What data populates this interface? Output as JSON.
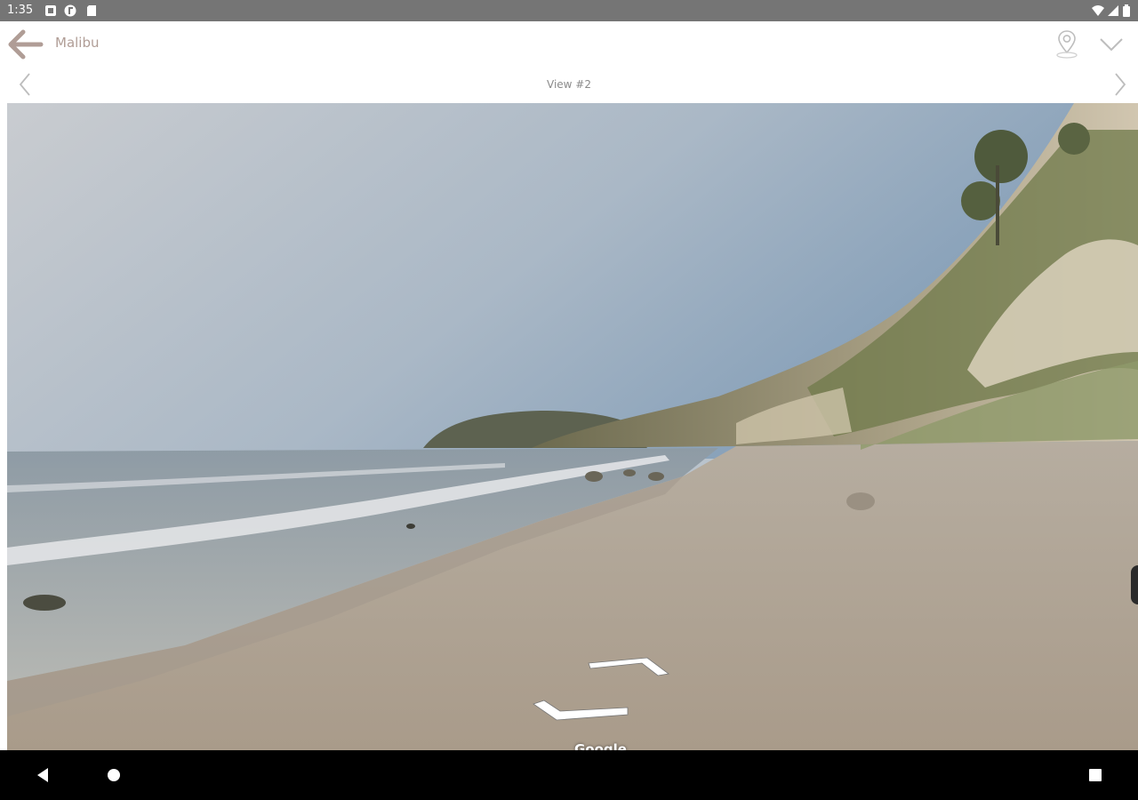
{
  "status_bar": {
    "time": "1:35",
    "icons": [
      "notification-icon",
      "app-badge-icon",
      "sd-card-icon",
      "wifi-icon",
      "signal-icon",
      "battery-icon"
    ]
  },
  "app_bar": {
    "title": "Malibu",
    "back_icon": "arrow-left-icon",
    "pin_icon": "map-pin-icon",
    "expand_icon": "chevron-down-icon"
  },
  "view_bar": {
    "label": "View #2",
    "prev_icon": "chevron-left-icon",
    "next_icon": "chevron-right-icon"
  },
  "street_view": {
    "watermark": "Google",
    "forward_arrow_icon": "nav-chevron-forward-icon",
    "back_arrow_icon": "nav-chevron-back-icon"
  },
  "system_nav": {
    "back_icon": "triangle-back-icon",
    "home_icon": "circle-home-icon",
    "recents_icon": "square-recents-icon"
  },
  "colors": {
    "accent": "#b09d96",
    "status_bar": "#757575",
    "nav_bar": "#000000"
  }
}
